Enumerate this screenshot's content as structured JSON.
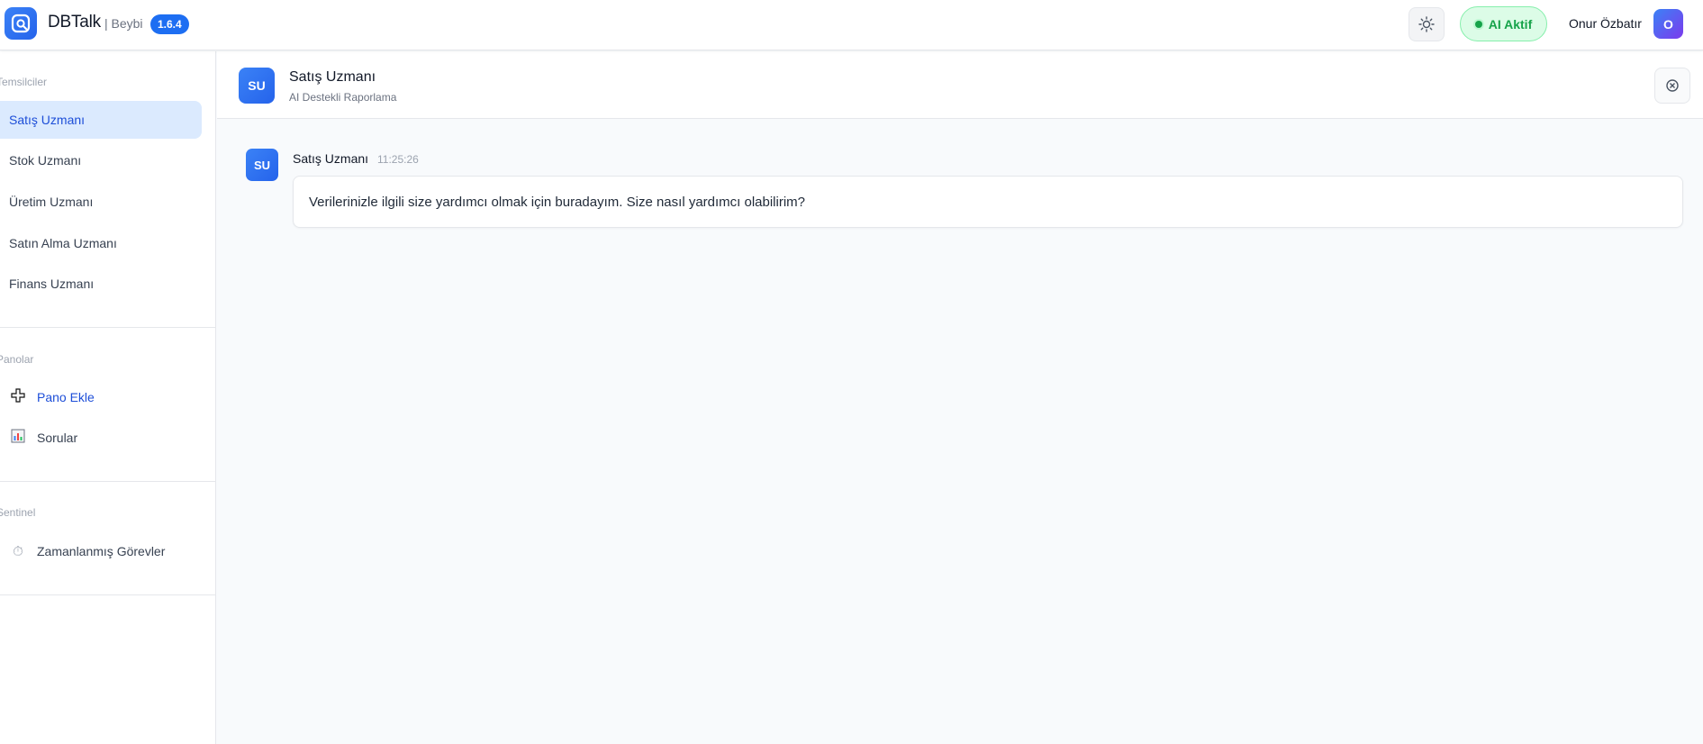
{
  "header": {
    "app_name": "DBTalk",
    "app_sub": "| Beybi",
    "version": "1.6.4",
    "theme_icon": "sun-icon",
    "ai_status": "AI Aktif",
    "user_name": "Onur Özbatır",
    "user_initial": "O"
  },
  "sidebar": {
    "agents_title": "Temsilciler",
    "agents": [
      {
        "label": "Satış Uzmanı",
        "active": true
      },
      {
        "label": "Stok Uzmanı",
        "active": false
      },
      {
        "label": "Üretim Uzmanı",
        "active": false
      },
      {
        "label": "Satın Alma Uzmanı",
        "active": false
      },
      {
        "label": "Finans Uzmanı",
        "active": false
      }
    ],
    "boards_title": "Panolar",
    "boards": [
      {
        "label": "Pano Ekle",
        "icon": "plus-icon"
      },
      {
        "label": "Sorular",
        "icon": "bar-chart-icon"
      }
    ],
    "sentinel_title": "Sentinel",
    "sentinel": [
      {
        "label": "Zamanlanmış Görevler",
        "icon": "stopwatch-icon"
      }
    ]
  },
  "agent_header": {
    "initials": "SU",
    "name": "Satış Uzmanı",
    "subtitle": "AI Destekli Raporlama"
  },
  "messages": [
    {
      "initials": "SU",
      "sender": "Satış Uzmanı",
      "time": "11:25:26",
      "text": "Verilerinizle ilgili size yardımcı olmak için buradayım. Size nasıl yardımcı olabilirim?"
    }
  ],
  "colors": {
    "accent": "#2563eb",
    "active_bg": "#dbeafe",
    "ai_green": "#16a34a"
  }
}
